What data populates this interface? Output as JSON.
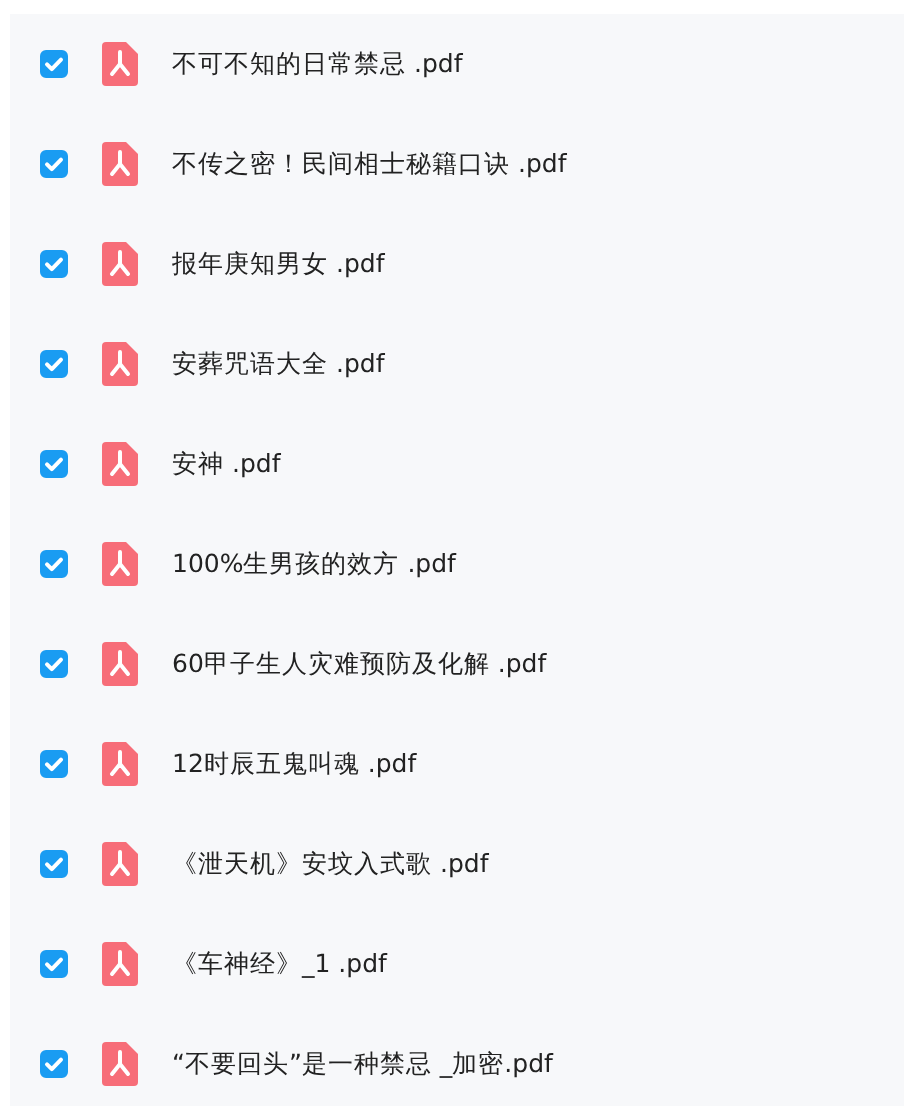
{
  "files": [
    {
      "name": "不可不知的日常禁忌 .pdf",
      "checked": true
    },
    {
      "name": "不传之密！民间相士秘籍口诀 .pdf",
      "checked": true
    },
    {
      "name": "报年庚知男女 .pdf",
      "checked": true
    },
    {
      "name": "安葬咒语大全 .pdf",
      "checked": true
    },
    {
      "name": "安神 .pdf",
      "checked": true
    },
    {
      "name": "100%生男孩的效方 .pdf",
      "checked": true
    },
    {
      "name": "60甲子生人灾难预防及化解 .pdf",
      "checked": true
    },
    {
      "name": "12时辰五鬼叫魂 .pdf",
      "checked": true
    },
    {
      "name": "《泄天机》安坟入式歌 .pdf",
      "checked": true
    },
    {
      "name": "《车神经》_1 .pdf",
      "checked": true
    },
    {
      "name": "“不要回头”是一种禁忌 _加密.pdf",
      "checked": true
    }
  ]
}
